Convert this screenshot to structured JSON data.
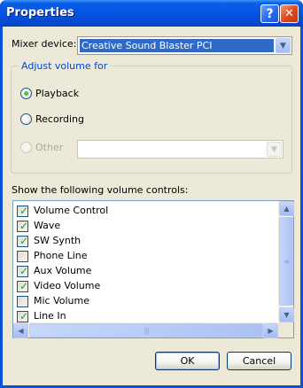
{
  "window": {
    "title": "Properties"
  },
  "titlebar": {
    "help_label": "?",
    "close_label": "✕"
  },
  "mixer": {
    "label": "Mixer device:",
    "selected": "Creative Sound Blaster PCI"
  },
  "adjust_group": {
    "title": "Adjust volume for",
    "options": [
      {
        "label": "Playback",
        "selected": true,
        "enabled": true
      },
      {
        "label": "Recording",
        "selected": false,
        "enabled": true
      },
      {
        "label": "Other",
        "selected": false,
        "enabled": false
      }
    ],
    "other_select_value": ""
  },
  "controls": {
    "label": "Show the following volume controls:",
    "items": [
      {
        "label": "Volume Control",
        "checked": true
      },
      {
        "label": "Wave",
        "checked": true
      },
      {
        "label": "SW Synth",
        "checked": true
      },
      {
        "label": "Phone Line",
        "checked": false
      },
      {
        "label": "Aux Volume",
        "checked": true
      },
      {
        "label": "Video Volume",
        "checked": true
      },
      {
        "label": "Mic Volume",
        "checked": false
      },
      {
        "label": "Line In",
        "checked": true
      }
    ]
  },
  "buttons": {
    "ok": "OK",
    "cancel": "Cancel"
  },
  "colors": {
    "titlebar": "#0554e2",
    "selection": "#316ac5",
    "group_title": "#0046d5",
    "check_green": "#21a121",
    "dialog_bg": "#ece9d8"
  },
  "icons": {
    "dropdown": "chevron-down-icon",
    "scroll_up": "arrow-up-icon",
    "scroll_down": "arrow-down-icon",
    "scroll_left": "arrow-left-icon",
    "scroll_right": "arrow-right-icon"
  }
}
